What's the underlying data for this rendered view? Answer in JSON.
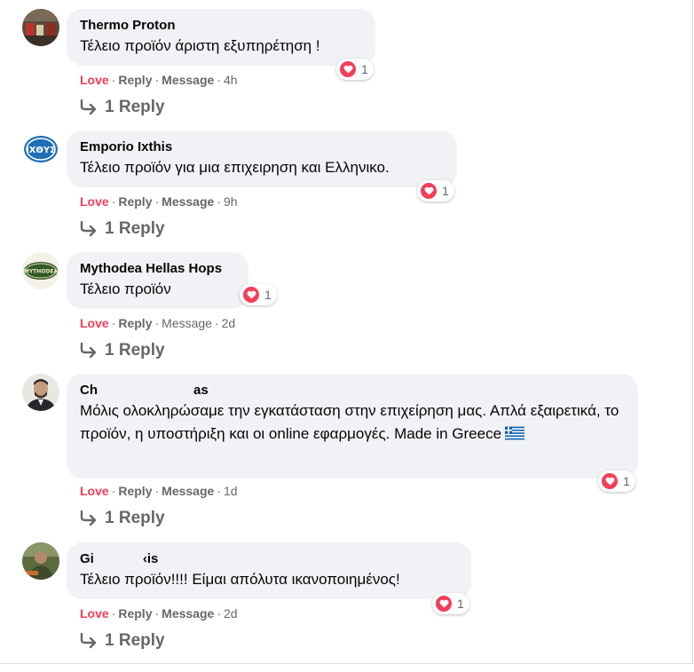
{
  "comments": [
    {
      "author": "Thermo Proton",
      "text": "Τέλειο προϊόν άριστη εξυπηρέτηση !",
      "reactions": "1",
      "love": "Love",
      "reply": "Reply",
      "message": "Message",
      "time": "4h",
      "replies": "1 Reply",
      "avatar_icon": "store-photo-avatar"
    },
    {
      "author": "Emporio Ixthis",
      "text": "Τέλειο προϊόν για μια επιχειρηση και Ελληνικο.",
      "reactions": "1",
      "love": "Love",
      "reply": "Reply",
      "message": "Message",
      "time": "9h",
      "replies": "1 Reply",
      "avatar_icon": "ichthys-logo-avatar"
    },
    {
      "author": "Mythodea Hellas Hops",
      "text": "Τέλειο προϊόν",
      "reactions": "1",
      "love": "Love",
      "reply": "Reply",
      "message": "Message",
      "time": "2d",
      "replies": "1 Reply",
      "avatar_icon": "mythodea-logo-avatar"
    },
    {
      "author_start": "Ch",
      "author_end": "as",
      "text": "Μόλις ολοκληρώσαμε την εγκατάσταση στην επιχείρηση μας. Απλά εξαιρετικά, το προϊόν, η υποστήριξη και οι online εφαρμογές. Made in Greece",
      "reactions": "1",
      "love": "Love",
      "reply": "Reply",
      "message": "Message",
      "time": "1d",
      "replies": "1 Reply",
      "avatar_icon": "man-portrait-avatar",
      "flag_icon": "greece-flag-emoji"
    },
    {
      "author_start": "Gi",
      "author_end": "‹is",
      "text": "Τέλειο προϊόν!!!! Είμαι απόλυτα ικανοποιημένος!",
      "reactions": "1",
      "love": "Love",
      "reply": "Reply",
      "message": "Message",
      "time": "2d",
      "replies": "1 Reply",
      "avatar_icon": "person-outdoor-avatar"
    }
  ],
  "colors": {
    "bubble": "#f0f2f5",
    "love": "#f33e58",
    "meta": "#65676b"
  }
}
